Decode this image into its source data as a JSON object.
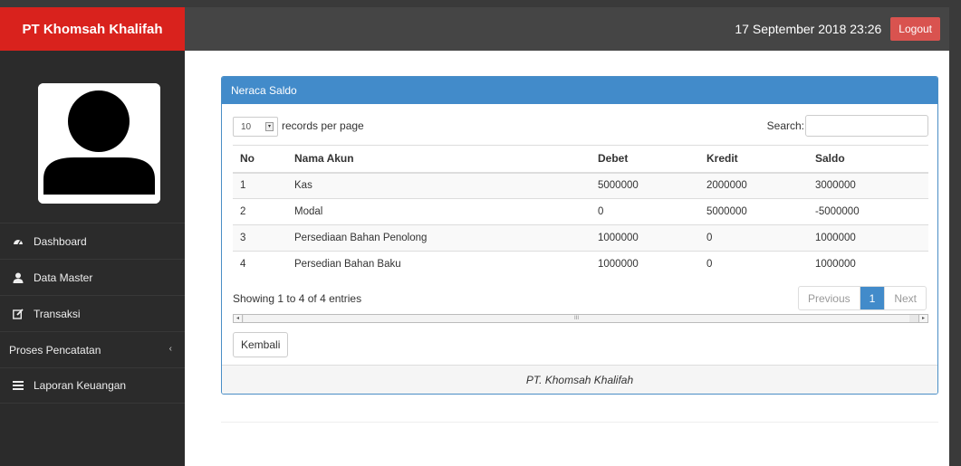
{
  "header": {
    "brand": "PT Khomsah Khalifah",
    "datetime": "17 September 2018 23:26",
    "logout_label": "Logout"
  },
  "sidebar": {
    "items": [
      {
        "label": "Dashboard",
        "icon": "dashboard-icon"
      },
      {
        "label": "Data Master",
        "icon": "user-icon"
      },
      {
        "label": "Transaksi",
        "icon": "edit-icon"
      },
      {
        "label": "Proses Pencatatan",
        "icon": "",
        "chevron": "‹"
      },
      {
        "label": "Laporan Keuangan",
        "icon": "list-icon"
      }
    ]
  },
  "panel": {
    "title": "Neraca Saldo",
    "footer": "PT. Khomsah Khalifah",
    "length_value": "10",
    "length_label": "records per page",
    "search_label": "Search:",
    "search_value": "",
    "columns": [
      "No",
      "Nama Akun",
      "Debet",
      "Kredit",
      "Saldo"
    ],
    "rows": [
      [
        "1",
        "Kas",
        "5000000",
        "2000000",
        "3000000"
      ],
      [
        "2",
        "Modal",
        "0",
        "5000000",
        "-5000000"
      ],
      [
        "3",
        "Persediaan Bahan Penolong",
        "1000000",
        "0",
        "1000000"
      ],
      [
        "4",
        "Persedian Bahan Baku",
        "1000000",
        "0",
        "1000000"
      ]
    ],
    "info": "Showing 1 to 4 of 4 entries",
    "pager": {
      "previous": "Previous",
      "current": "1",
      "next": "Next"
    },
    "back_label": "Kembali",
    "scroll_thumb_mark": "III"
  }
}
